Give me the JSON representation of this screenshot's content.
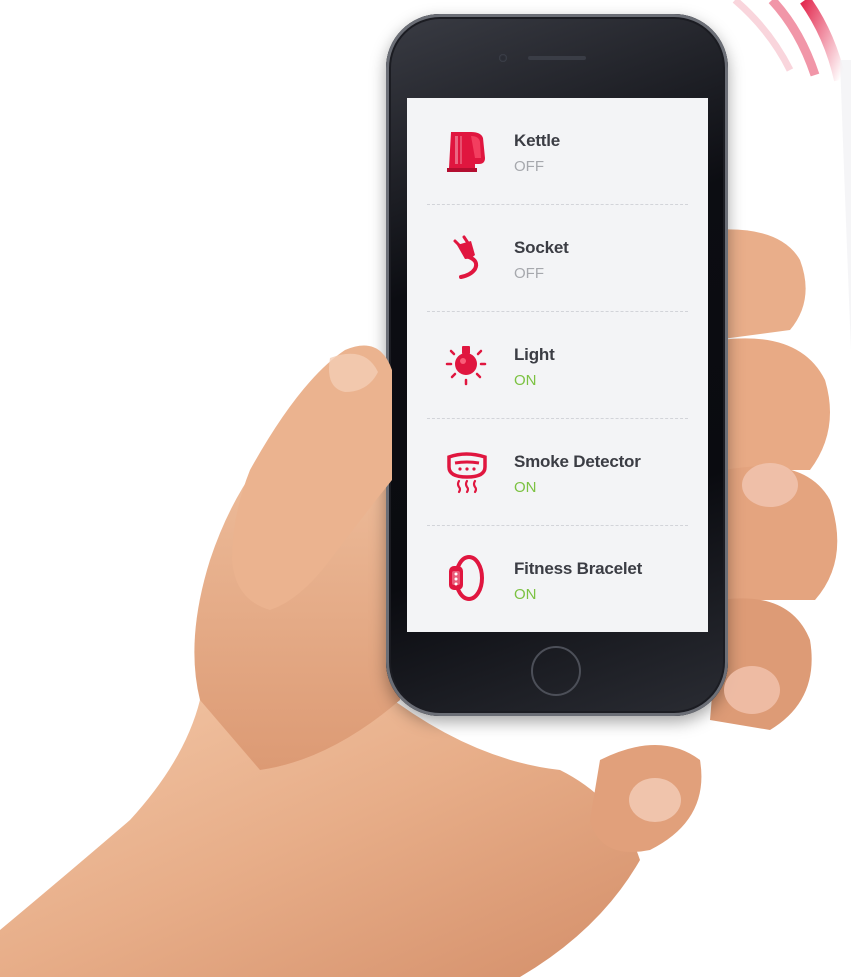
{
  "app": {
    "accent_color": "#e0163f",
    "on_color": "#7cc242",
    "off_color": "#a6a8ad"
  },
  "devices": [
    {
      "name": "Kettle",
      "status": "OFF",
      "icon": "kettle-icon"
    },
    {
      "name": "Socket",
      "status": "OFF",
      "icon": "plug-icon"
    },
    {
      "name": "Light",
      "status": "ON",
      "icon": "light-bulb-icon"
    },
    {
      "name": "Smoke Detector",
      "status": "ON",
      "icon": "smoke-detector-icon"
    },
    {
      "name": "Fitness Bracelet",
      "status": "ON",
      "icon": "fitness-bracelet-icon"
    }
  ]
}
